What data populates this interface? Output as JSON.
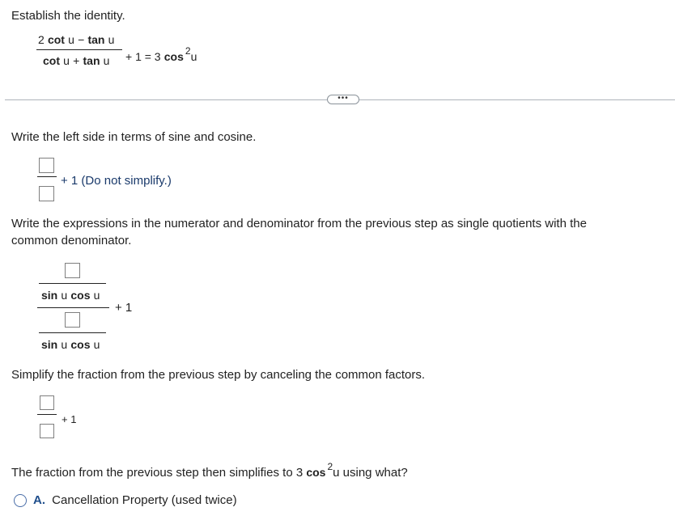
{
  "prompt": "Establish the identity.",
  "identity": {
    "num_coef": "2",
    "cot": "cot",
    "u": "u",
    "minus": "−",
    "tan": "tan",
    "plus": "+",
    "rhs_plus_one": "+ 1 = 3",
    "cos": "cos",
    "exp": "2"
  },
  "more_button": "•••",
  "step1": {
    "instruction": "Write the left side in terms of sine and cosine.",
    "suffix": "+ 1 (Do not simplify.)"
  },
  "step2": {
    "instruction_line1": "Write the expressions in the numerator and denominator from the previous step as single quotients with the",
    "instruction_line2": "common denominator.",
    "sin": "sin",
    "cos": "cos",
    "u": "u",
    "plus_one": "+ 1"
  },
  "step3": {
    "instruction": "Simplify the fraction from the previous step by canceling the common factors.",
    "plus_one": "+ 1"
  },
  "step4": {
    "question_prefix": "The fraction from the previous step then simplifies to 3",
    "cos": "cos",
    "exp": "2",
    "question_suffix": "u using what?"
  },
  "options": [
    {
      "letter": "A.",
      "label": "Cancellation Property (used twice)"
    }
  ]
}
